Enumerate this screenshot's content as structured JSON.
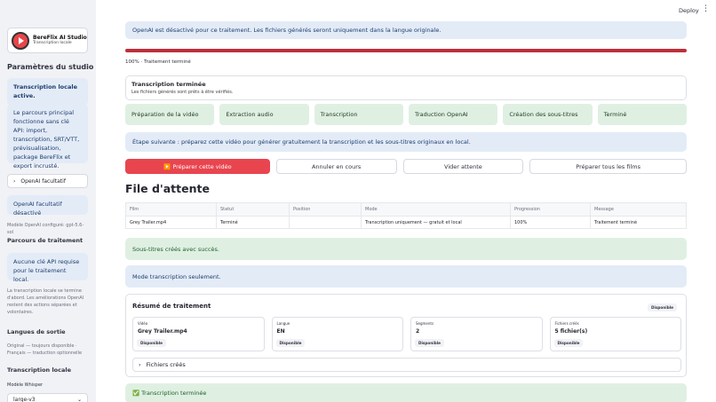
{
  "app": {
    "deploy_label": "Deploy",
    "menu_icon": "kebab-menu-icon"
  },
  "sidebar": {
    "logo_title": "BereFlix AI Studio",
    "logo_sub": "Transcription locale",
    "params_heading": "Paramètres du studio",
    "transcription_box": "Transcription locale active.",
    "pipeline_box": "Le parcours principal fonctionne sans clé API: import, transcription, SRT/VTT, prévisualisation, package BereFlix et export incrusté.",
    "openai_expander": "OpenAI facultatif",
    "openai_disabled": "OpenAI facultatif désactivé",
    "openai_model": "Modèle OpenAI configuré: gpt-5.6-sol",
    "route_heading": "Parcours de traitement",
    "no_key_box": "Aucune clé API requise pour le traitement local.",
    "route_note": "La transcription locale se termine d'abord. Les améliorations OpenAI restent des actions séparées et volontaires.",
    "output_heading": "Langues de sortie",
    "output_note": "Original — toujours disponible · Français — traduction optionnelle",
    "local_heading": "Transcription locale",
    "whisper_label": "Modèle Whisper",
    "whisper_value": "large-v3"
  },
  "main": {
    "notice": "OpenAI est désactivé pour ce traitement. Les fichiers générés seront uniquement dans la langue originale.",
    "progress_percent": 100,
    "progress_text": "100% · Traitement terminé",
    "done_title": "Transcription terminée",
    "done_sub": "Les fichiers générés sont prêts à être vérifiés.",
    "steps": [
      {
        "label": "Préparation de la vidéo"
      },
      {
        "label": "Extraction audio"
      },
      {
        "label": "Transcription"
      },
      {
        "label": "Traduction OpenAI"
      },
      {
        "label": "Création des sous-titres"
      },
      {
        "label": "Terminé"
      }
    ],
    "next_step": "Étape suivante : préparez cette vidéo pour générer gratuitement la transcription et les sous-titres originaux en local.",
    "buttons": {
      "prepare": "▶️ Préparer cette vidéo",
      "cancel": "Annuler en cours",
      "clear": "Vider attente",
      "prepare_all": "Préparer tous les films"
    },
    "queue_title": "File d'attente",
    "queue": {
      "headers": [
        "Film",
        "Statut",
        "Position",
        "Mode",
        "Progression",
        "Message"
      ],
      "rows": [
        [
          "Grey Trailer.mp4",
          "Terminé",
          "",
          "Transcription uniquement — gratuit et local",
          "100%",
          "Traitement terminé"
        ]
      ]
    },
    "subs_created": "Sous-titres créés avec succès.",
    "mode_note": "Mode transcription seulement.",
    "summary": {
      "title": "Résumé de traitement",
      "badge": "Disponible",
      "cards": [
        {
          "label": "Vidéo",
          "value": "Grey Trailer.mp4",
          "badge": "Disponible"
        },
        {
          "label": "Langue",
          "value": "EN",
          "badge": "Disponible"
        },
        {
          "label": "Segments",
          "value": "2",
          "badge": "Disponible"
        },
        {
          "label": "Fichiers créés",
          "value": "5 fichier(s)",
          "badge": "Disponible"
        }
      ],
      "files_expander": "Fichiers créés"
    },
    "final_status": "✅ Transcription terminée"
  },
  "colors": {
    "accent": "#bd2f3a",
    "primary_button": "#e8454f",
    "info_bg": "#e3ebf7",
    "success_bg": "#dff0e2"
  }
}
